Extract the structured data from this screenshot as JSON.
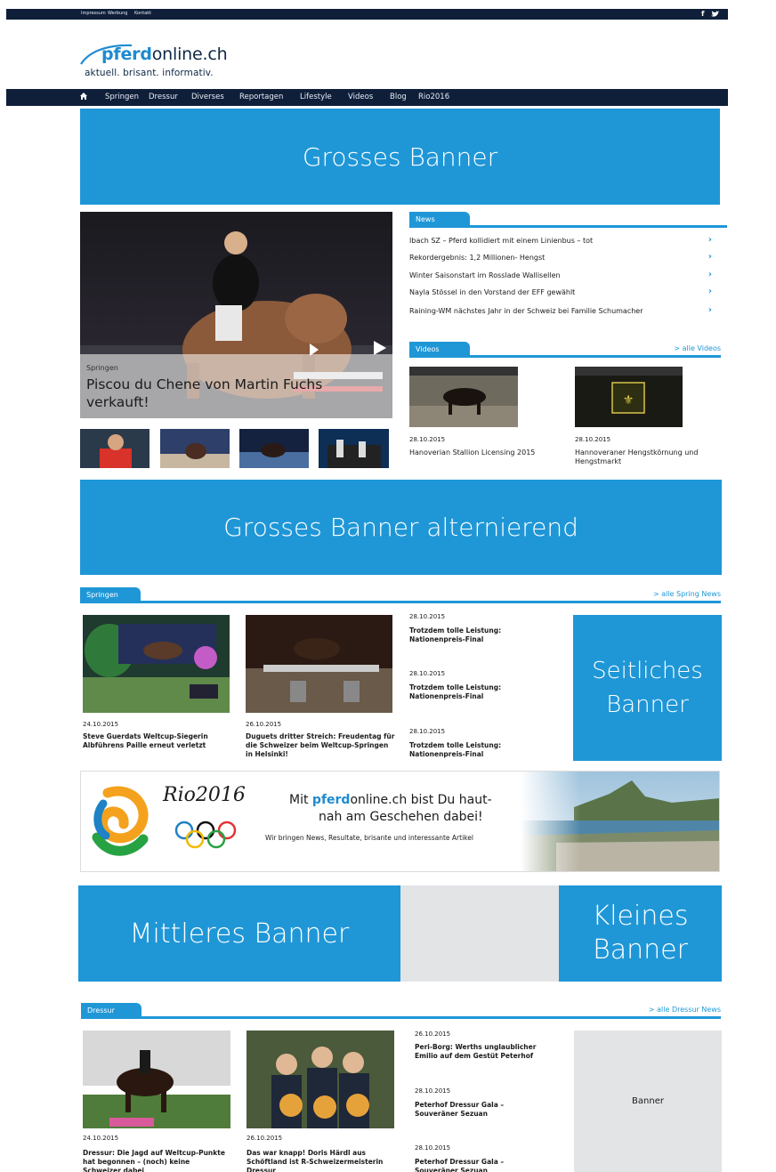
{
  "topbar": {
    "links": [
      "Impressum",
      "Werbung",
      "Kontakt"
    ],
    "social": [
      "f",
      "twitter-icon"
    ]
  },
  "logo": {
    "name_highlight": "pferd",
    "name_rest": "online.ch",
    "tagline": "aktuell. brisant. informativ."
  },
  "nav": {
    "items": [
      "Springen",
      "Dressur",
      "Diverses",
      "Reportagen",
      "Lifestyle",
      "Videos",
      "Blog",
      "Rio2016"
    ]
  },
  "banners": {
    "top": "Grosses Banner",
    "alternating": "Grosses Banner alternierend",
    "side": "Seitliches Banner",
    "middle": "Mittleres Banner",
    "small": "Kleines Banner",
    "dressur_side": "Banner"
  },
  "hero": {
    "category": "Springen",
    "title": "Piscou du Chene von Martin Fuchs verkauft!"
  },
  "news": {
    "title": "News",
    "items": [
      "Ibach SZ – Pferd kollidiert mit einem Linienbus – tot",
      "Rekordergebnis: 1,2 Millionen- Hengst",
      "Winter Saisonstart im Rosslade Wallisellen",
      "Nayla Stössel in den Vorstand der EFF gewählt",
      "Raining-WM nächstes Jahr in der Schweiz bei Familie Schumacher"
    ]
  },
  "videos": {
    "title": "Videos",
    "more": "> alle Videos",
    "items": [
      {
        "date": "28.10.2015",
        "title": "Hanoverian Stallion Licensing 2015"
      },
      {
        "date": "28.10.2015",
        "title": "Hannoveraner Hengstkörnung und Hengstmarkt"
      }
    ]
  },
  "springen": {
    "title": "Springen",
    "more": "> alle Spring News",
    "cards": [
      {
        "date": "24.10.2015",
        "title": "Steve Guerdats Weltcup-Siegerin Albführens Paille erneut verletzt"
      },
      {
        "date": "26.10.2015",
        "title": "Duguets dritter Streich: Freudentag für die Schweizer beim Weltcup-Springen in Helsinki!"
      }
    ],
    "list": [
      {
        "date": "28.10.2015",
        "title": "Trotzdem tolle Leistung: Nationenpreis-Final"
      },
      {
        "date": "28.10.2015",
        "title": "Trotzdem tolle Leistung: Nationenpreis-Final"
      },
      {
        "date": "28.10.2015",
        "title": "Trotzdem tolle Leistung: Nationenpreis-Final"
      }
    ]
  },
  "rio_ad": {
    "logo_text": "Rio2016",
    "line1_pre": "Mit ",
    "line1_hl": "pferd",
    "line1_post": "online.ch bist Du haut-",
    "line2": "nah am Geschehen dabei!",
    "line3": "Wir bringen News, Resultate, brisante und interessante Artikel"
  },
  "dressur": {
    "title": "Dressur",
    "more": "> alle Dressur News",
    "cards": [
      {
        "date": "24.10.2015",
        "title": "Dressur: Die Jagd auf Weltcup-Punkte hat begonnen – (noch) keine Schweizer dabei"
      },
      {
        "date": "26.10.2015",
        "title": "Das war knapp! Doris Härdl aus Schöftland ist R-Schweizermeisterin Dressur"
      }
    ],
    "list": [
      {
        "date": "26.10.2015",
        "title": "Peri-Borg: Werths unglaublicher Emilio auf dem Gestüt Peterhof"
      },
      {
        "date": "28.10.2015",
        "title": "Peterhof Dressur Gala – Souveräner Sezuan"
      },
      {
        "date": "28.10.2015",
        "title": "Peterhof Dressur Gala – Souveräner Sezuan"
      }
    ]
  }
}
